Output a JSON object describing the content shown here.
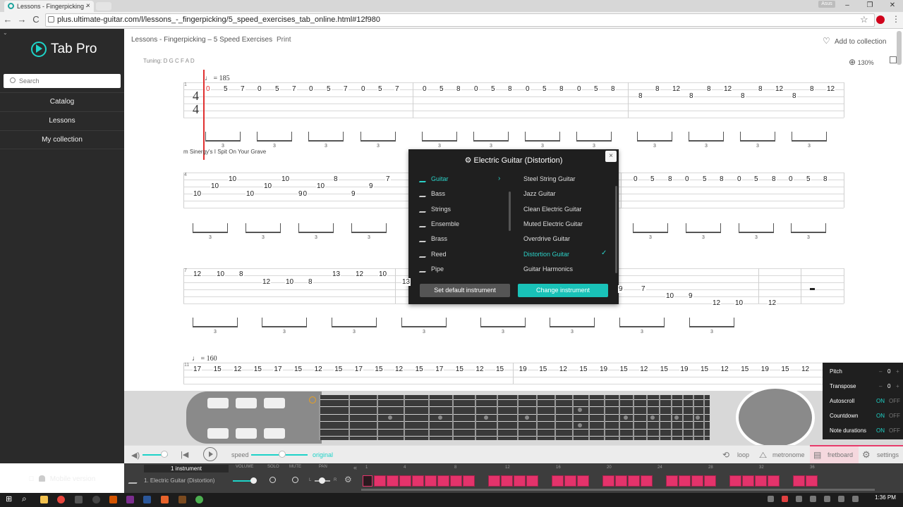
{
  "browser": {
    "tab_title": "Lessons - Fingerpicking -",
    "tab_close": "×",
    "url": "plus.ultimate-guitar.com/l/lessons_-_fingerpicking/5_speed_exercises_tab_online.html#12f980",
    "user_badge": "Asus",
    "back": "←",
    "forward": "→",
    "reload": "C",
    "star": "☆",
    "kebab": "⋮",
    "win_min": "–",
    "win_max": "❐",
    "win_close": "✕"
  },
  "sidebar": {
    "collapse": "⌄",
    "logo": "Tab Pro",
    "search_placeholder": "Search",
    "items": [
      {
        "label": "Catalog"
      },
      {
        "label": "Lessons"
      },
      {
        "label": "My collection"
      }
    ],
    "mobile_label": "Mobile version"
  },
  "header": {
    "breadcrumb": "Lessons - Fingerpicking – 5 Speed Exercises",
    "print": "Print",
    "add_collection": "Add to collection",
    "heart": "♡"
  },
  "tab": {
    "tuning": "Tuning: D G C F A D",
    "zoom": "130%",
    "zoom_icon": "⊕",
    "tempo1": "♩ = 185",
    "tempo2": "♩ = 160",
    "time_sig": "4\n4",
    "lyric": "m Sinergy's I Spit On Your Grave",
    "triplet": "3",
    "measure_numbers": [
      "1",
      "4",
      "7",
      "11"
    ],
    "row1": {
      "numbers": [
        "0",
        "5",
        "7",
        "0",
        "5",
        "7",
        "0",
        "5",
        "7",
        "0",
        "5",
        "7",
        "0",
        "5",
        "8",
        "0",
        "5",
        "8",
        "0",
        "5",
        "8",
        "0",
        "5",
        "8"
      ],
      "upper": [
        "8",
        "12",
        "8",
        "12",
        "8",
        "12",
        "8",
        "12"
      ],
      "lower": [
        "8",
        "8",
        "8",
        "8"
      ]
    },
    "row2": {
      "left": [
        "10",
        "10",
        "10",
        "10",
        "10",
        "10",
        "10",
        "10",
        "9",
        "8",
        "9",
        "9",
        "7"
      ],
      "right": [
        "0",
        "5",
        "8",
        "0",
        "5",
        "8",
        "0",
        "5",
        "8",
        "0",
        "5",
        "8"
      ]
    },
    "row3": {
      "left": [
        "12",
        "10",
        "8",
        "12",
        "10",
        "8",
        "13",
        "12",
        "10",
        "13"
      ],
      "right": [
        "9",
        "7",
        "10",
        "9",
        "12",
        "10",
        "12"
      ]
    },
    "row4": [
      "17",
      "15",
      "12",
      "15",
      "17",
      "15",
      "12",
      "15",
      "17",
      "15",
      "12",
      "15",
      "17",
      "15",
      "12",
      "15",
      "19",
      "15",
      "12",
      "15",
      "19",
      "15",
      "12",
      "15",
      "19",
      "15",
      "12",
      "15",
      "19",
      "15",
      "12"
    ]
  },
  "dialog": {
    "title": "Electric Guitar (Distortion)",
    "gear": "⚙",
    "close": "×",
    "arrow": "›",
    "check": "✓",
    "categories": [
      {
        "label": "Guitar",
        "selected": true
      },
      {
        "label": "Bass"
      },
      {
        "label": "Strings"
      },
      {
        "label": "Ensemble"
      },
      {
        "label": "Brass"
      },
      {
        "label": "Reed"
      },
      {
        "label": "Pipe"
      }
    ],
    "instruments": [
      {
        "label": "Steel String Guitar"
      },
      {
        "label": "Jazz Guitar"
      },
      {
        "label": "Clean Electric Guitar"
      },
      {
        "label": "Muted Electric Guitar"
      },
      {
        "label": "Overdrive Guitar"
      },
      {
        "label": "Distortion Guitar",
        "selected": true
      },
      {
        "label": "Guitar Harmonics"
      }
    ],
    "set_default": "Set default instrument",
    "change": "Change instrument"
  },
  "player": {
    "volume_icon": "◀)",
    "prev": "|◀",
    "speed": "speed",
    "original": "original",
    "loop": "loop",
    "metronome": "metronome",
    "fretboard": "fretboard",
    "settings": "settings",
    "loop_icon": "⟲",
    "metronome_icon": "⧍",
    "fretboard_icon": "▤",
    "settings_icon": "⚙",
    "volume_level": 0.85,
    "speed_level": 0.55
  },
  "settings_panel": {
    "pitch": {
      "label": "Pitch",
      "value": "0"
    },
    "transpose": {
      "label": "Transpose",
      "value": "0"
    },
    "minus": "–",
    "plus": "+",
    "autoscroll": {
      "label": "Autoscroll",
      "on": "ON",
      "off": "OFF"
    },
    "countdown": {
      "label": "Countdown",
      "on": "ON",
      "off": "OFF"
    },
    "note_durations": {
      "label": "Note durations",
      "on": "ON",
      "off": "OFF"
    }
  },
  "tracks": {
    "header": "1 instrument",
    "cols": [
      "VOLUME",
      "SOLO",
      "MUTE",
      "PAN"
    ],
    "name": "1. Electric Guitar (Distortion)",
    "pan_l": "L",
    "pan_r": "R",
    "back": "«",
    "gear": "⚙",
    "timeline_numbers": [
      "1",
      "4",
      "8",
      "12",
      "16",
      "20",
      "24",
      "28",
      "32",
      "36"
    ]
  },
  "taskbar": {
    "time": "1:36 PM",
    "date": "",
    "start": "⊞",
    "search": "⌕"
  },
  "colors": {
    "accent": "#1ed3c8",
    "track_block": "#e4336b",
    "sidebar": "#2a2a2a",
    "dialog": "#1f1f1f"
  }
}
